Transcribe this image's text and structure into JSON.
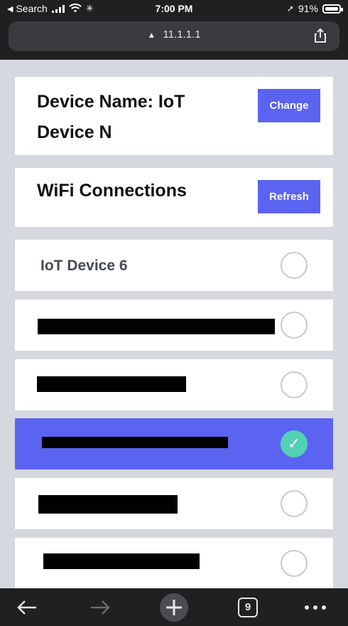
{
  "status_bar": {
    "back_app": "Search",
    "time": "7:00 PM",
    "battery_percent": "91%",
    "battery_level": 0.91
  },
  "browser": {
    "url": "11.1.1.1",
    "tab_count": "9",
    "icons": {
      "back": "arrow-left-icon",
      "forward": "arrow-right-icon",
      "new_tab": "plus-icon",
      "tabs": "tabs-icon",
      "more": "more-dots-icon",
      "share": "share-icon",
      "warning": "warning-icon"
    }
  },
  "device": {
    "title": "Device Name: IoT Device N",
    "change_label": "Change"
  },
  "wifi": {
    "title": "WiFi Connections",
    "refresh_label": "Refresh",
    "networks": [
      {
        "name": "IoT Device 6",
        "selected": false
      },
      {
        "name": "",
        "selected": false
      },
      {
        "name": "",
        "selected": false
      },
      {
        "name": "",
        "selected": true
      },
      {
        "name": "",
        "selected": false
      },
      {
        "name": "",
        "selected": false
      }
    ]
  },
  "colors": {
    "accent": "#5b63f1",
    "selected_check": "#52d1b4",
    "background": "#d5d8de",
    "chrome": "#1f2022"
  }
}
